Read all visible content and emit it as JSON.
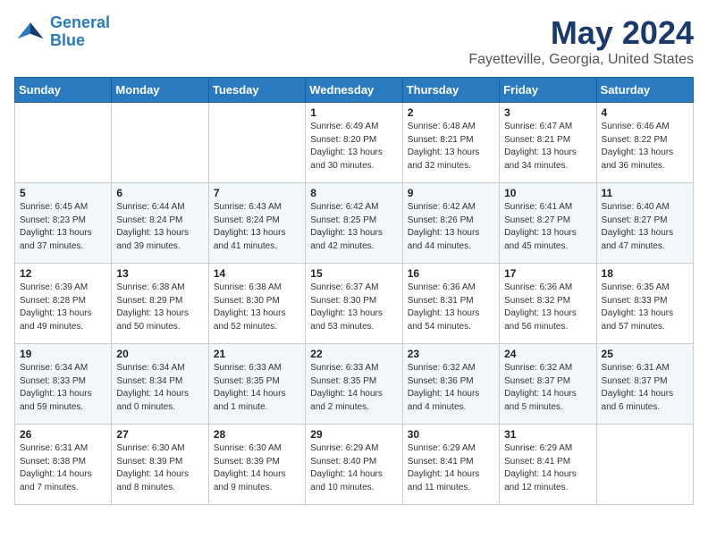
{
  "header": {
    "logo_line1": "General",
    "logo_line2": "Blue",
    "title": "May 2024",
    "subtitle": "Fayetteville, Georgia, United States"
  },
  "columns": [
    "Sunday",
    "Monday",
    "Tuesday",
    "Wednesday",
    "Thursday",
    "Friday",
    "Saturday"
  ],
  "weeks": [
    [
      {
        "day": "",
        "info": ""
      },
      {
        "day": "",
        "info": ""
      },
      {
        "day": "",
        "info": ""
      },
      {
        "day": "1",
        "info": "Sunrise: 6:49 AM\nSunset: 8:20 PM\nDaylight: 13 hours\nand 30 minutes."
      },
      {
        "day": "2",
        "info": "Sunrise: 6:48 AM\nSunset: 8:21 PM\nDaylight: 13 hours\nand 32 minutes."
      },
      {
        "day": "3",
        "info": "Sunrise: 6:47 AM\nSunset: 8:21 PM\nDaylight: 13 hours\nand 34 minutes."
      },
      {
        "day": "4",
        "info": "Sunrise: 6:46 AM\nSunset: 8:22 PM\nDaylight: 13 hours\nand 36 minutes."
      }
    ],
    [
      {
        "day": "5",
        "info": "Sunrise: 6:45 AM\nSunset: 8:23 PM\nDaylight: 13 hours\nand 37 minutes."
      },
      {
        "day": "6",
        "info": "Sunrise: 6:44 AM\nSunset: 8:24 PM\nDaylight: 13 hours\nand 39 minutes."
      },
      {
        "day": "7",
        "info": "Sunrise: 6:43 AM\nSunset: 8:24 PM\nDaylight: 13 hours\nand 41 minutes."
      },
      {
        "day": "8",
        "info": "Sunrise: 6:42 AM\nSunset: 8:25 PM\nDaylight: 13 hours\nand 42 minutes."
      },
      {
        "day": "9",
        "info": "Sunrise: 6:42 AM\nSunset: 8:26 PM\nDaylight: 13 hours\nand 44 minutes."
      },
      {
        "day": "10",
        "info": "Sunrise: 6:41 AM\nSunset: 8:27 PM\nDaylight: 13 hours\nand 45 minutes."
      },
      {
        "day": "11",
        "info": "Sunrise: 6:40 AM\nSunset: 8:27 PM\nDaylight: 13 hours\nand 47 minutes."
      }
    ],
    [
      {
        "day": "12",
        "info": "Sunrise: 6:39 AM\nSunset: 8:28 PM\nDaylight: 13 hours\nand 49 minutes."
      },
      {
        "day": "13",
        "info": "Sunrise: 6:38 AM\nSunset: 8:29 PM\nDaylight: 13 hours\nand 50 minutes."
      },
      {
        "day": "14",
        "info": "Sunrise: 6:38 AM\nSunset: 8:30 PM\nDaylight: 13 hours\nand 52 minutes."
      },
      {
        "day": "15",
        "info": "Sunrise: 6:37 AM\nSunset: 8:30 PM\nDaylight: 13 hours\nand 53 minutes."
      },
      {
        "day": "16",
        "info": "Sunrise: 6:36 AM\nSunset: 8:31 PM\nDaylight: 13 hours\nand 54 minutes."
      },
      {
        "day": "17",
        "info": "Sunrise: 6:36 AM\nSunset: 8:32 PM\nDaylight: 13 hours\nand 56 minutes."
      },
      {
        "day": "18",
        "info": "Sunrise: 6:35 AM\nSunset: 8:33 PM\nDaylight: 13 hours\nand 57 minutes."
      }
    ],
    [
      {
        "day": "19",
        "info": "Sunrise: 6:34 AM\nSunset: 8:33 PM\nDaylight: 13 hours\nand 59 minutes."
      },
      {
        "day": "20",
        "info": "Sunrise: 6:34 AM\nSunset: 8:34 PM\nDaylight: 14 hours\nand 0 minutes."
      },
      {
        "day": "21",
        "info": "Sunrise: 6:33 AM\nSunset: 8:35 PM\nDaylight: 14 hours\nand 1 minute."
      },
      {
        "day": "22",
        "info": "Sunrise: 6:33 AM\nSunset: 8:35 PM\nDaylight: 14 hours\nand 2 minutes."
      },
      {
        "day": "23",
        "info": "Sunrise: 6:32 AM\nSunset: 8:36 PM\nDaylight: 14 hours\nand 4 minutes."
      },
      {
        "day": "24",
        "info": "Sunrise: 6:32 AM\nSunset: 8:37 PM\nDaylight: 14 hours\nand 5 minutes."
      },
      {
        "day": "25",
        "info": "Sunrise: 6:31 AM\nSunset: 8:37 PM\nDaylight: 14 hours\nand 6 minutes."
      }
    ],
    [
      {
        "day": "26",
        "info": "Sunrise: 6:31 AM\nSunset: 8:38 PM\nDaylight: 14 hours\nand 7 minutes."
      },
      {
        "day": "27",
        "info": "Sunrise: 6:30 AM\nSunset: 8:39 PM\nDaylight: 14 hours\nand 8 minutes."
      },
      {
        "day": "28",
        "info": "Sunrise: 6:30 AM\nSunset: 8:39 PM\nDaylight: 14 hours\nand 9 minutes."
      },
      {
        "day": "29",
        "info": "Sunrise: 6:29 AM\nSunset: 8:40 PM\nDaylight: 14 hours\nand 10 minutes."
      },
      {
        "day": "30",
        "info": "Sunrise: 6:29 AM\nSunset: 8:41 PM\nDaylight: 14 hours\nand 11 minutes."
      },
      {
        "day": "31",
        "info": "Sunrise: 6:29 AM\nSunset: 8:41 PM\nDaylight: 14 hours\nand 12 minutes."
      },
      {
        "day": "",
        "info": ""
      }
    ]
  ]
}
